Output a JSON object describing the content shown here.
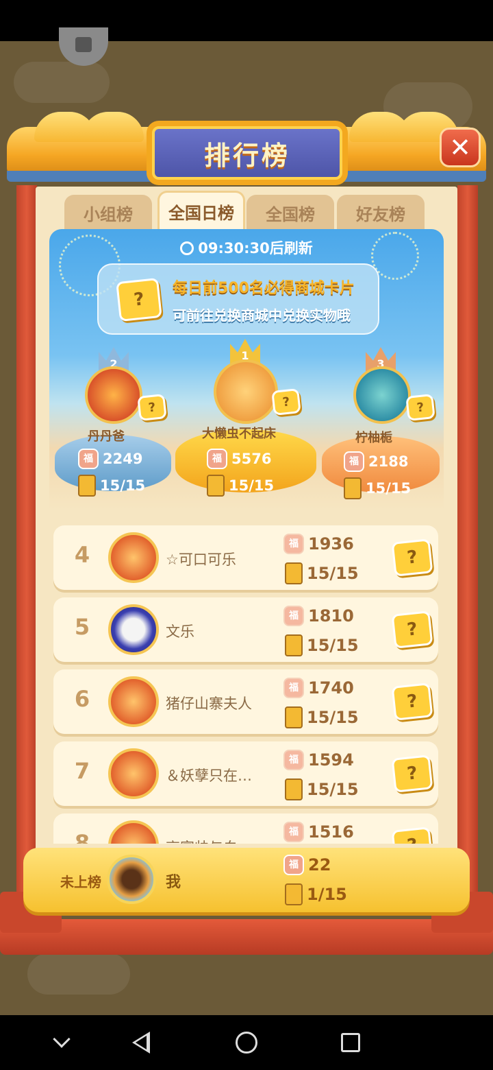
{
  "title": "排行榜",
  "tabs": [
    {
      "label": "小组榜",
      "active": false
    },
    {
      "label": "全国日榜",
      "active": true
    },
    {
      "label": "全国榜",
      "active": false
    },
    {
      "label": "好友榜",
      "active": false
    }
  ],
  "refresh_timer": "09:30:30后刷新",
  "banner": {
    "line1": "每日前500名必得商城卡片",
    "line2": "可前往兑换商城中兑换实物哦",
    "card_icon": "?"
  },
  "podium": [
    {
      "rank": "1",
      "name": "大懒虫不起床",
      "score": "5576",
      "progress": "15/15"
    },
    {
      "rank": "2",
      "name": "丹丹爸",
      "score": "2249",
      "progress": "15/15"
    },
    {
      "rank": "3",
      "name": "柠柚栀",
      "score": "2188",
      "progress": "15/15"
    }
  ],
  "list": [
    {
      "rank": "4",
      "name": "☆可口可乐",
      "score": "1936",
      "progress": "15/15"
    },
    {
      "rank": "5",
      "name": "文乐",
      "score": "1810",
      "progress": "15/15"
    },
    {
      "rank": "6",
      "name": "猪仔山寨夫人",
      "score": "1740",
      "progress": "15/15"
    },
    {
      "rank": "7",
      "name": "＆妖孽只在…",
      "score": "1594",
      "progress": "15/15"
    },
    {
      "rank": "8",
      "name": "高富帅与白",
      "score": "1516",
      "progress": ""
    }
  ],
  "me": {
    "rank_label": "未上榜",
    "name": "我",
    "score": "22",
    "progress": "1/15"
  },
  "icons": {
    "fu": "福",
    "close": "✕",
    "question": "?"
  },
  "colors": {
    "gold": "#f6c12f",
    "frame_red": "#c9472c",
    "plaque_blue": "#5a62b8",
    "panel_bg": "#f6e6c2"
  }
}
